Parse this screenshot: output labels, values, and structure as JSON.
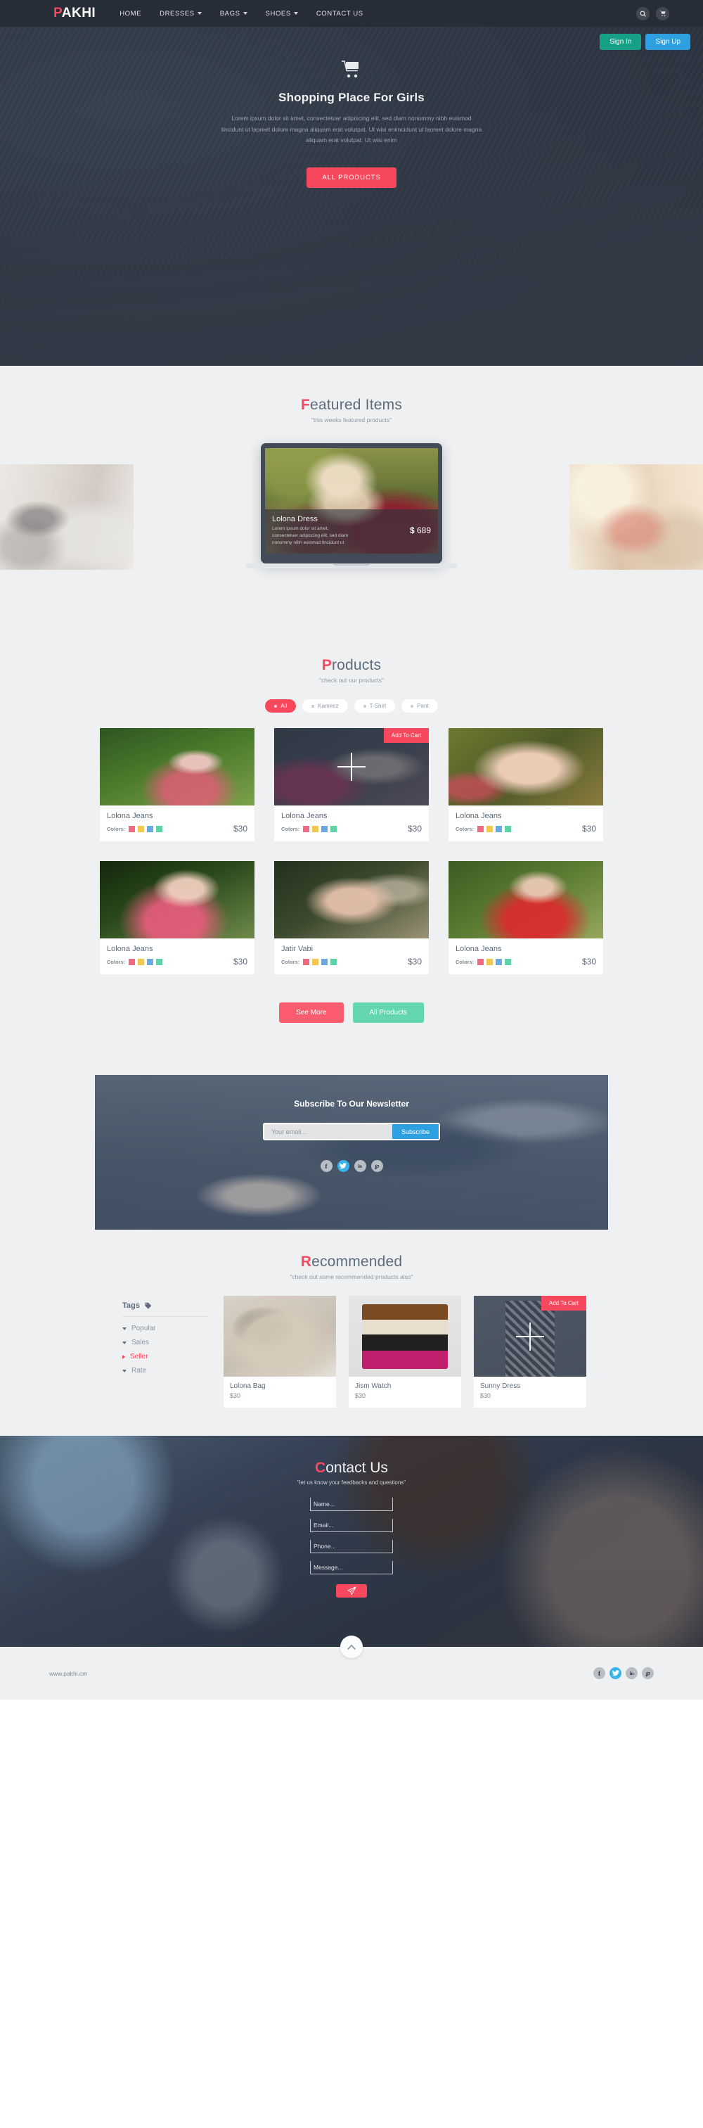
{
  "navbar": {
    "brand_accent": "P",
    "brand_rest": "AKHI",
    "links": [
      {
        "label": "HOME",
        "caret": false
      },
      {
        "label": "DRESSES",
        "caret": true
      },
      {
        "label": "BAGS",
        "caret": true
      },
      {
        "label": "SHOES",
        "caret": true
      },
      {
        "label": "CONTACT US",
        "caret": false
      }
    ],
    "search_icon": "search-icon",
    "cart_icon": "cart-icon",
    "search_glyph": "⌕",
    "cart_glyph": "🛒"
  },
  "auth": {
    "sign_in": "Sign In",
    "sign_up": "Sign Up",
    "sign_in_color": "#16a085",
    "sign_up_color": "#2e9fe0"
  },
  "hero": {
    "cart_glyph": "🛒",
    "title": "Shopping Place For Girls",
    "subtitle": "Lorem ipsum dolor sit amet, consectetuer adipiscing elit, sed diam nonummy nibh euismod tincidunt ut laoreet dolore magna aliquam erat volutpat. Ut wisi enimcidunt ut laoreet dolore magna aliquam erat volutpat. Ut wisi enim",
    "cta": "ALL PRODUCTS",
    "cta_color": "#f8485e"
  },
  "featured": {
    "title_accent": "F",
    "title_rest": "eatured Items",
    "subtitle": "\"this weeks featured products\"",
    "showcase": {
      "name": "Lolona Dress",
      "desc": "Lorem ipsum dolor sit amet, consectetuer adipiscing elit, sed diam nonummy nibh euismod tincidunt ut",
      "currency": "$",
      "price": "689"
    }
  },
  "products": {
    "title_accent": "P",
    "title_rest": "roducts",
    "subtitle": "\"check out our products\"",
    "filters": [
      {
        "label": "All",
        "active": true
      },
      {
        "label": "Kameez",
        "active": false
      },
      {
        "label": "T-Shirt",
        "active": false
      },
      {
        "label": "Pant",
        "active": false
      }
    ],
    "colors_label": "Colors:",
    "swatch_colors": [
      "#f0697f",
      "#f0c850",
      "#6aaae4",
      "#5fd2a8"
    ],
    "add_to_cart_label": "Add To Cart",
    "items": [
      {
        "name": "Lolona Jeans",
        "price": "$30",
        "hovered": false
      },
      {
        "name": "Lolona Jeans",
        "price": "$30",
        "hovered": true
      },
      {
        "name": "Lolona Jeans",
        "price": "$30",
        "hovered": false
      },
      {
        "name": "Lolona Jeans",
        "price": "$30",
        "hovered": false
      },
      {
        "name": "Jatir Vabi",
        "price": "$30",
        "hovered": false
      },
      {
        "name": "Lolona Jeans",
        "price": "$30",
        "hovered": false
      }
    ],
    "see_more": "See More",
    "all_products": "All Products",
    "see_more_color": "#fc5d6e",
    "all_products_color": "#64d6b0"
  },
  "newsletter": {
    "title": "Subscribe To Our Newsletter",
    "input_placeholder": "Your email...",
    "input_value": "",
    "button": "Subscribe",
    "button_color": "#2e9fe0",
    "socials": [
      {
        "name": "facebook-icon",
        "glyph": "f",
        "active": false
      },
      {
        "name": "twitter-icon",
        "glyph": "🐦",
        "active": true
      },
      {
        "name": "linkedin-icon",
        "glyph": "in",
        "active": false
      },
      {
        "name": "pinterest-icon",
        "glyph": "℘",
        "active": false
      }
    ]
  },
  "recommended": {
    "title_accent": "R",
    "title_rest": "ecommended",
    "subtitle": "\"check out some recommended products also\"",
    "tags_heading": "Tags",
    "tags_icon": "tag-icon",
    "tags": [
      {
        "label": "Popular",
        "active": false
      },
      {
        "label": "Sales",
        "active": false
      },
      {
        "label": "Seller",
        "active": true
      },
      {
        "label": "Rate",
        "active": false
      }
    ],
    "add_to_cart_label": "Add To Cart",
    "items": [
      {
        "name": "Lolona Bag",
        "price": "$30",
        "hovered": false
      },
      {
        "name": "Jism Watch",
        "price": "$30",
        "hovered": false
      },
      {
        "name": "Sunny Dress",
        "price": "$30",
        "hovered": true
      }
    ]
  },
  "contact": {
    "title_accent": "C",
    "title_rest": "ontact Us",
    "subtitle": "\"let us know your feedbacks and questions\"",
    "fields": [
      {
        "name": "name-field",
        "placeholder": "Name...",
        "value": ""
      },
      {
        "name": "email-field",
        "placeholder": "Email...",
        "value": ""
      },
      {
        "name": "phone-field",
        "placeholder": "Phone...",
        "value": ""
      },
      {
        "name": "message-field",
        "placeholder": "Message...",
        "value": ""
      }
    ],
    "send_glyph": "➤",
    "send_color": "#f8485e"
  },
  "footer": {
    "url": "www.pakhi.cm",
    "scroll_top_glyph": "∧",
    "socials": [
      {
        "name": "facebook-icon",
        "glyph": "f",
        "active": false
      },
      {
        "name": "twitter-icon",
        "glyph": "🐦",
        "active": true
      },
      {
        "name": "linkedin-icon",
        "glyph": "in",
        "active": false
      },
      {
        "name": "pinterest-icon",
        "glyph": "℘",
        "active": false
      }
    ]
  }
}
